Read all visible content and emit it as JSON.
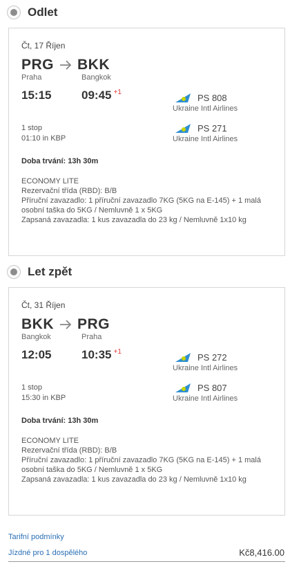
{
  "outbound": {
    "heading": "Odlet",
    "date": "Čt, 17 Říjen",
    "from_code": "PRG",
    "to_code": "BKK",
    "from_city": "Praha",
    "to_city": "Bangkok",
    "dep_time": "15:15",
    "arr_time": "09:45",
    "arr_offset": "+1",
    "segments": [
      {
        "flight_no": "PS 808",
        "airline": "Ukraine Intl Airlines"
      },
      {
        "flight_no": "PS 271",
        "airline": "Ukraine Intl Airlines"
      }
    ],
    "stops": "1 stop",
    "layover": "01:10 in KBP",
    "duration": "Doba trvání: 13h 30m",
    "fare_lines": [
      "ECONOMY LITE",
      "Rezervační třída (RBD):  B/B",
      "Příruční zavazadlo: 1 příruční zavazadlo 7KG (5KG na E-145) + 1 malá osobní taška do 5KG / Nemluvně 1 x 5KG",
      "Zapsaná zavazadla: 1 kus zavazadla do 23 kg / Nemluvně 1x10 kg"
    ]
  },
  "return": {
    "heading": "Let zpět",
    "date": "Čt, 31 Říjen",
    "from_code": "BKK",
    "to_code": "PRG",
    "from_city": "Bangkok",
    "to_city": "Praha",
    "dep_time": "12:05",
    "arr_time": "10:35",
    "arr_offset": "+1",
    "segments": [
      {
        "flight_no": "PS 272",
        "airline": "Ukraine Intl Airlines"
      },
      {
        "flight_no": "PS 807",
        "airline": "Ukraine Intl Airlines"
      }
    ],
    "stops": "1 stop",
    "layover": "15:30 in KBP",
    "duration": "Doba trvání: 13h 30m",
    "fare_lines": [
      "ECONOMY LITE",
      "Rezervační třída (RBD):  B/B",
      "Příruční zavazadlo: 1 příruční zavazadlo 7KG (5KG na E-145) + 1 malá osobní taška do 5KG / Nemluvně 1 x 5KG",
      "Zapsaná zavazadla: 1 kus zavazadla do 23 kg / Nemluvně 1x10 kg"
    ]
  },
  "footer": {
    "fare_rules_link": "Tarifní podmínky",
    "passenger_link": "Jízdné pro 1 dospělého",
    "price": "Kč8,416.00"
  },
  "colors": {
    "link": "#2a6fb5",
    "offset": "#e03a3a",
    "airline_logo_primary": "#2f8fd1",
    "airline_logo_accent": "#c8d400"
  }
}
